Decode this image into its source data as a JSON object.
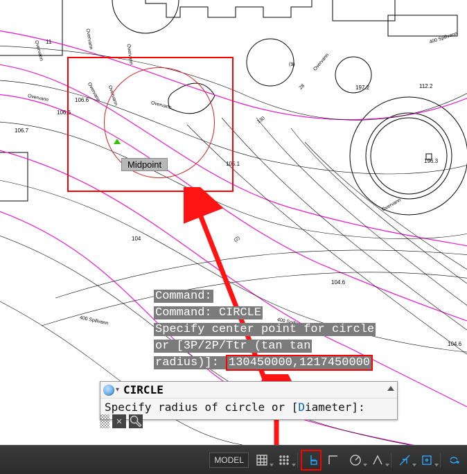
{
  "drawing": {
    "snap_tooltip": "Midpoint",
    "labels": {
      "overvann": "Overvann",
      "spillvann": "400 Spillvann"
    },
    "elevations": [
      "11",
      "106.7",
      "106.6",
      "106.6",
      "197.2",
      "112.2",
      "105.1",
      "196.3",
      "104.6",
      "104.6",
      "104",
      "(2)",
      "(9)",
      "130",
      "28"
    ]
  },
  "command_history": {
    "line1": "Command:",
    "line2": "Command: CIRCLE",
    "line3a": "Specify center point for circle",
    "line3b": "or [3P/2P/Ttr (tan tan",
    "line3c": "radius)]: ",
    "coords": "130450000,1217450000"
  },
  "command_line": {
    "active_command": "CIRCLE",
    "prompt_before": "Specify radius of circle or [",
    "prompt_hot": "D",
    "prompt_after": "iameter]:",
    "caret": "▾"
  },
  "status_bar": {
    "model_label": "MODEL"
  }
}
